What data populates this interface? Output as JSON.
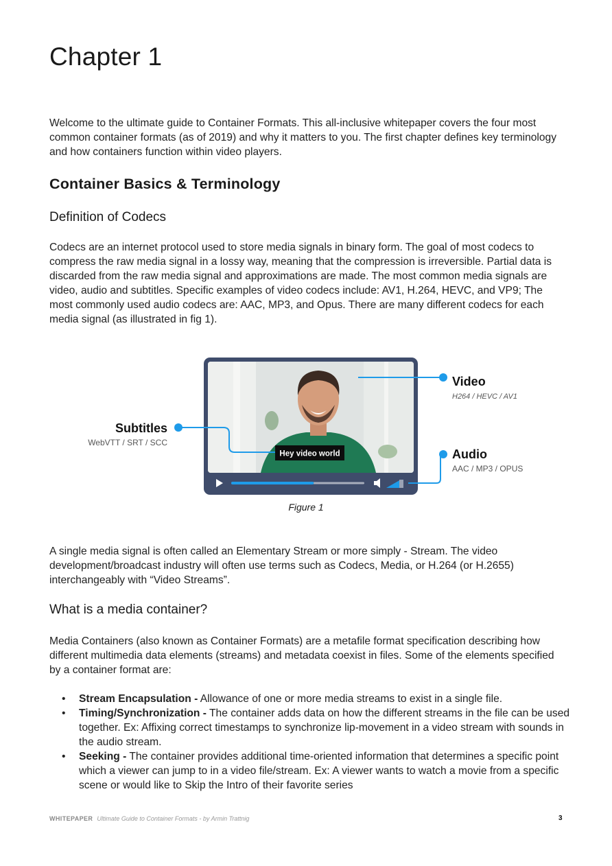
{
  "chapter_title": "Chapter 1",
  "intro": "Welcome to the ultimate guide to Container Formats. This all-inclusive whitepaper covers the four most common container formats (as of 2019) and why it matters to you. The first chapter defines key terminology and how containers function within video players.",
  "section_title": "Container Basics & Terminology",
  "subsection1_title": "Definition of Codecs",
  "codecs_paragraph": "Codecs are an internet protocol used to store media signals in binary form. The goal of most codecs to compress the raw media signal in a lossy way, meaning that the compression is irreversible. Partial data is discarded from the raw media signal and approximations are made. The most common media signals are video, audio and subtitles. Specific examples of video codecs include: AV1, H.264, HEVC, and VP9; The most commonly used audio codecs are: AAC, MP3, and Opus. There are many different codecs for each media signal (as illustrated in fig 1).",
  "figure": {
    "video_label": "Video",
    "video_sub": "H264 / HEVC / AV1",
    "audio_label": "Audio",
    "audio_sub": "AAC / MP3 / OPUS",
    "subtitles_label": "Subtitles",
    "subtitles_sub": "WebVTT / SRT / SCC",
    "caption_overlay": "Hey video world",
    "caption": "Figure 1",
    "progress": 0.62,
    "accent": "#1e9be9",
    "frame_color": "#3f4c6b"
  },
  "stream_paragraph": "A single media signal is often called an Elementary Stream or more simply - Stream. The video development/broadcast industry will often use terms such as Codecs, Media, or H.264 (or H.2655) interchangeably with “Video Streams”.",
  "subsection2_title": "What is a media container?",
  "container_paragraph": "Media Containers (also known as Container Formats) are a metafile format specification describing how different multimedia data elements (streams) and metadata coexist in files. Some of the elements specified by a container format are:",
  "bullets": [
    {
      "term": "Stream Encapsulation -",
      "text": " Allowance of one or more media streams to exist in a single file."
    },
    {
      "term": "Timing/Synchronization -",
      "text": " The container adds data on how the different streams in the file can be used together. Ex: Affixing correct timestamps to synchronize lip-movement in a video stream with sounds in the audio stream."
    },
    {
      "term": "Seeking -",
      "text": " The container provides additional time-oriented information that determines a specific point which a viewer can jump to in a video file/stream. Ex: A viewer wants to watch a movie from a specific scene or would like to Skip the Intro of their favorite series"
    }
  ],
  "footer": {
    "tag": "WHITEPAPER",
    "subtitle": "Ultimate Guide to Container Formats - by Armin Trattnig",
    "page_number": "3"
  }
}
